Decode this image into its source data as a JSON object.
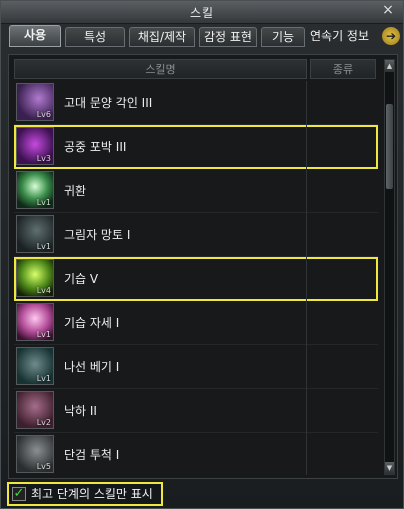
{
  "window": {
    "title": "스킬",
    "close_glyph": "×"
  },
  "tabs": [
    {
      "label": "사용"
    },
    {
      "label": "특성"
    },
    {
      "label": "채집/제작"
    },
    {
      "label": "감정 표현"
    },
    {
      "label": "기능"
    }
  ],
  "tab_more": {
    "label": "연속기 정보",
    "arrow": "➔"
  },
  "table": {
    "headers": [
      "스킬명",
      "종류"
    ],
    "rows": [
      {
        "name": "고대 문양 각인 III",
        "lv": "Lv6",
        "icon": "purple-rune-icon"
      },
      {
        "name": "공중 포박 III",
        "lv": "Lv3",
        "icon": "purple-grapple-icon"
      },
      {
        "name": "귀환",
        "lv": "Lv1",
        "icon": "green-return-icon"
      },
      {
        "name": "그림자 망토 I",
        "lv": "Lv1",
        "icon": "shadow-cloak-icon"
      },
      {
        "name": "기습 V",
        "lv": "Lv4",
        "icon": "green-ambush-icon"
      },
      {
        "name": "기습 자세 I",
        "lv": "Lv1",
        "icon": "pink-stance-icon"
      },
      {
        "name": "나선 베기 I",
        "lv": "Lv1",
        "icon": "spiral-slash-icon"
      },
      {
        "name": "낙하 II",
        "lv": "Lv2",
        "icon": "falling-icon"
      },
      {
        "name": "단검 투척 I",
        "lv": "Lv5",
        "icon": "dagger-throw-icon"
      }
    ]
  },
  "scroll": {
    "up": "▲",
    "down": "▼"
  },
  "footer": {
    "checkbox_label": "최고 단계의 스킬만 표시",
    "checked": "✓"
  }
}
